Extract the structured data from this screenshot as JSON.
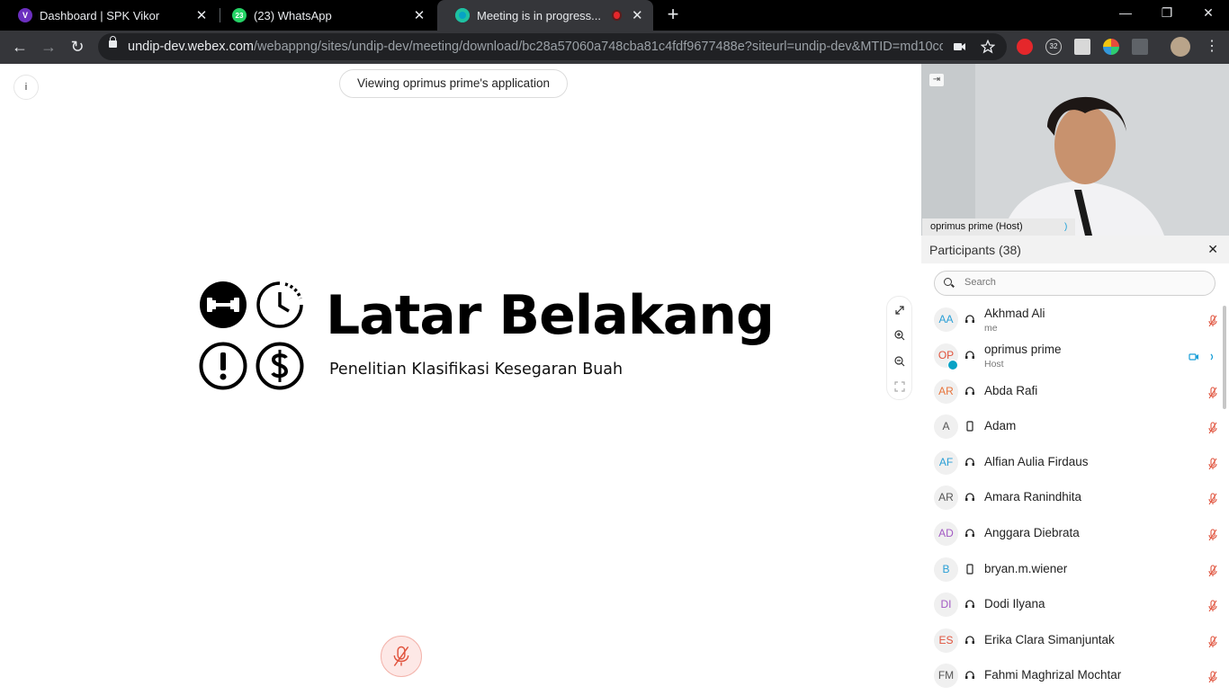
{
  "browser": {
    "tabs": [
      {
        "title": "Dashboard | SPK Vikor",
        "favicon_letter": "V",
        "favicon_color": "#6b2fbf"
      },
      {
        "title": "(23) WhatsApp",
        "favicon_letter": "23",
        "favicon_color": "#25d366"
      },
      {
        "title": "Meeting is in progress...",
        "favicon_letter": "",
        "favicon_color": "#07a2c5",
        "recording_color": "#e5272b"
      }
    ],
    "close_glyph": "✕",
    "new_tab_glyph": "+",
    "window": {
      "minimize": "—",
      "restore": "❐",
      "close": "✕"
    },
    "nav": {
      "back": "←",
      "forward": "→",
      "reload": "↻"
    },
    "url_host": "undip-dev.webex.com",
    "url_path": "/webappng/sites/undip-dev/meeting/download/bc28a57060a748cba81c4fdf9677488e?siteurl=undip-dev&MTID=md10cc...",
    "extension_badge": "32"
  },
  "meeting": {
    "viewing_label": "Viewing oprimus prime's application",
    "info_glyph": "i",
    "slide": {
      "title": "Latar Belakang",
      "subtitle": "Penelitian Klasifikasi Kesegaran Buah"
    },
    "video": {
      "name": "oprimus prime",
      "role": "(Host)"
    }
  },
  "participants": {
    "title": "Participants (38)",
    "close_glyph": "✕",
    "search_placeholder": "Search",
    "list": [
      {
        "initials": "AA",
        "name": "Akhmad Ali",
        "sub": "me",
        "device": "headset",
        "color": "#2a9fd6",
        "status": "muted"
      },
      {
        "initials": "OP",
        "name": "oprimus prime",
        "sub": "Host",
        "device": "headset",
        "color": "#e0533d",
        "status": "video"
      },
      {
        "initials": "AR",
        "name": "Abda Rafi",
        "sub": "",
        "device": "headset",
        "color": "#e8743b",
        "status": "muted"
      },
      {
        "initials": "A",
        "name": "Adam",
        "sub": "",
        "device": "phone",
        "color": "#555555",
        "status": "muted"
      },
      {
        "initials": "AF",
        "name": "Alfian Aulia Firdaus",
        "sub": "",
        "device": "headset",
        "color": "#2a9fd6",
        "status": "muted"
      },
      {
        "initials": "AR",
        "name": "Amara Ranindhita",
        "sub": "",
        "device": "headset",
        "color": "#555555",
        "status": "muted"
      },
      {
        "initials": "AD",
        "name": "Anggara Diebrata",
        "sub": "",
        "device": "headset",
        "color": "#a35ac4",
        "status": "muted"
      },
      {
        "initials": "B",
        "name": "bryan.m.wiener",
        "sub": "",
        "device": "phone",
        "color": "#2a9fd6",
        "status": "muted"
      },
      {
        "initials": "DI",
        "name": "Dodi Ilyana",
        "sub": "",
        "device": "headset",
        "color": "#a35ac4",
        "status": "muted"
      },
      {
        "initials": "ES",
        "name": "Erika Clara Simanjuntak",
        "sub": "",
        "device": "headset",
        "color": "#e0533d",
        "status": "muted"
      },
      {
        "initials": "FM",
        "name": "Fahmi Maghrizal Mochtar",
        "sub": "",
        "device": "headset",
        "color": "#555555",
        "status": "muted"
      }
    ]
  },
  "colors": {
    "muted": "#e0533d",
    "video": "#1a9fd8",
    "accent": "#07a2c5"
  }
}
